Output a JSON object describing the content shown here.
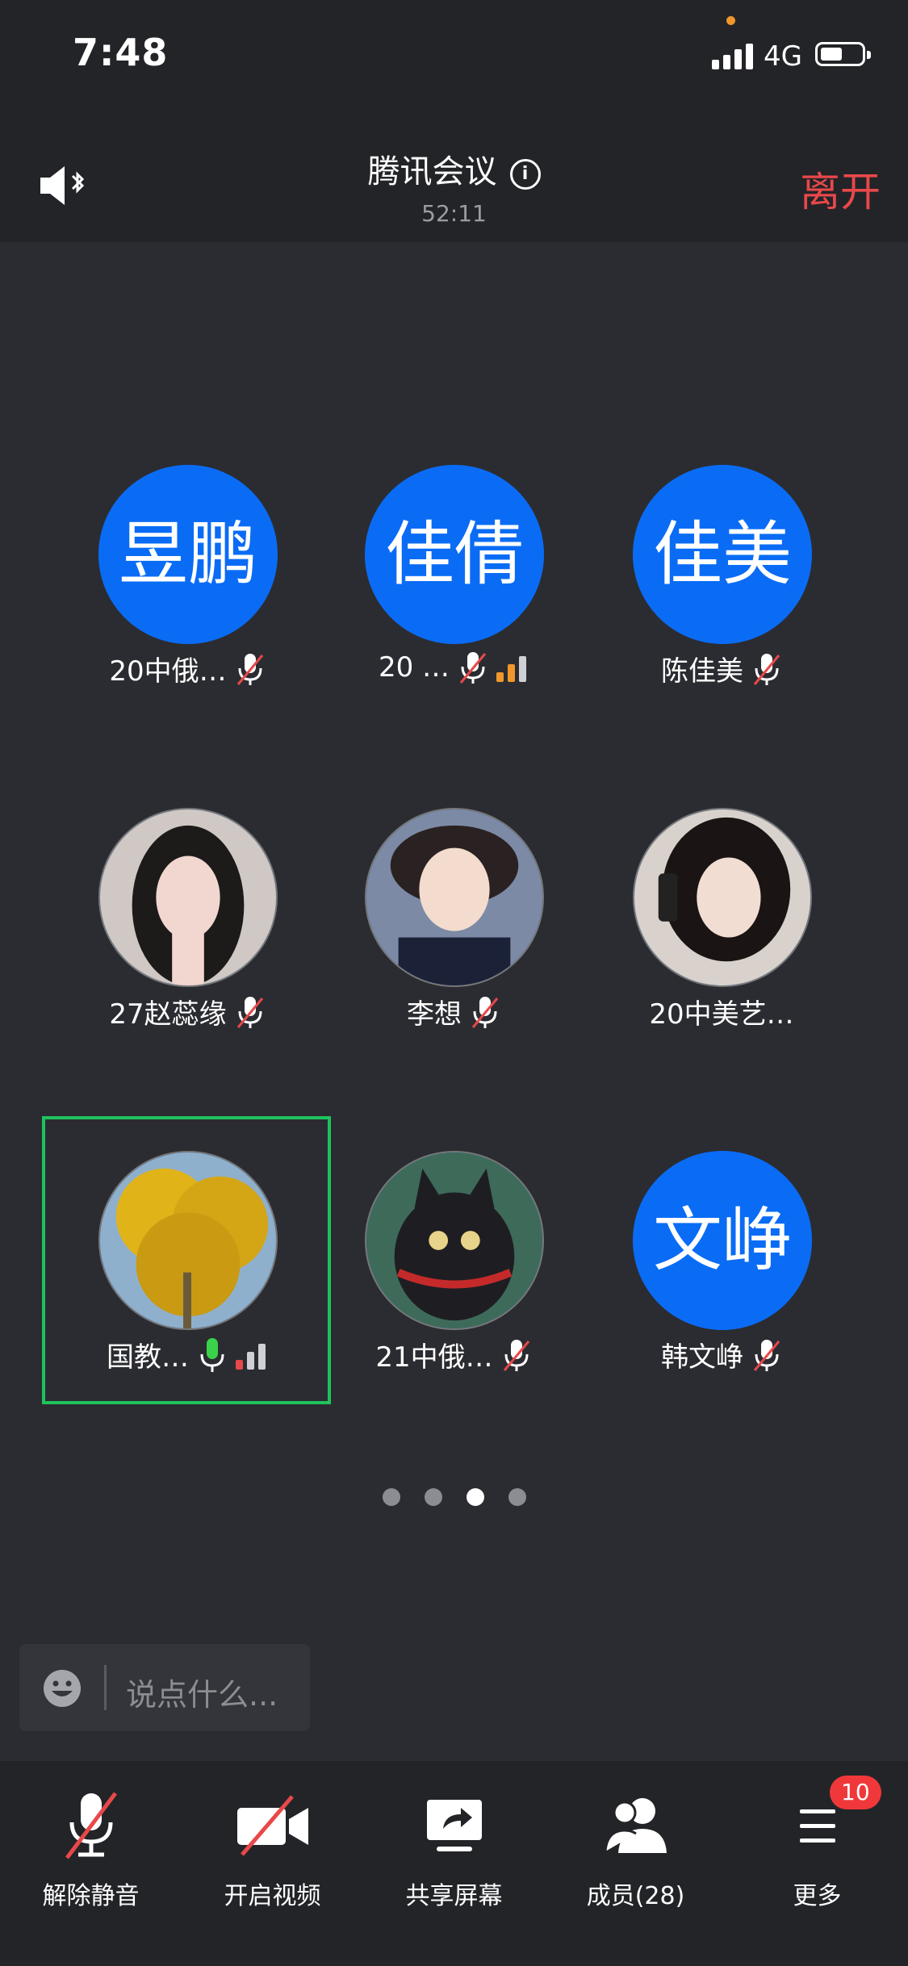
{
  "status_bar": {
    "time": "7:48",
    "network": "4G"
  },
  "header": {
    "title": "腾讯会议",
    "duration": "52:11",
    "leave_label": "离开"
  },
  "participants": [
    {
      "avatar_text": "昱鹏",
      "name": "20中俄…",
      "mic": "muted",
      "signal": "none"
    },
    {
      "avatar_text": "佳倩",
      "name": "20 …",
      "mic": "muted",
      "signal": "medium"
    },
    {
      "avatar_text": "佳美",
      "name": "陈佳美",
      "mic": "muted",
      "signal": "none"
    },
    {
      "avatar_text": "",
      "name": "27赵蕊缘",
      "mic": "muted",
      "signal": "none",
      "photo": "portrait-1"
    },
    {
      "avatar_text": "",
      "name": "李想",
      "mic": "muted",
      "signal": "none",
      "photo": "portrait-2"
    },
    {
      "avatar_text": "",
      "name": "20中美艺…",
      "mic": "none",
      "signal": "none",
      "photo": "portrait-3"
    },
    {
      "avatar_text": "",
      "name": "国教…",
      "mic": "active",
      "signal": "weak",
      "photo": "ginkgo-tree"
    },
    {
      "avatar_text": "",
      "name": "21中俄…",
      "mic": "muted",
      "signal": "none",
      "photo": "black-cat"
    },
    {
      "avatar_text": "文峥",
      "name": "韩文峥",
      "mic": "muted",
      "signal": "none"
    }
  ],
  "pagination": {
    "pages": 4,
    "current": 3
  },
  "chat_input": {
    "placeholder": "说点什么..."
  },
  "toolbar": {
    "unmute": "解除静音",
    "video": "开启视频",
    "share": "共享屏幕",
    "members": "成员(28)",
    "more": "更多",
    "more_badge": "10"
  },
  "colors": {
    "accent_blue": "#0a6cf5",
    "leave_red": "#e8484a",
    "speaking_green": "#1fc25c",
    "signal_orange": "#f0972c"
  }
}
